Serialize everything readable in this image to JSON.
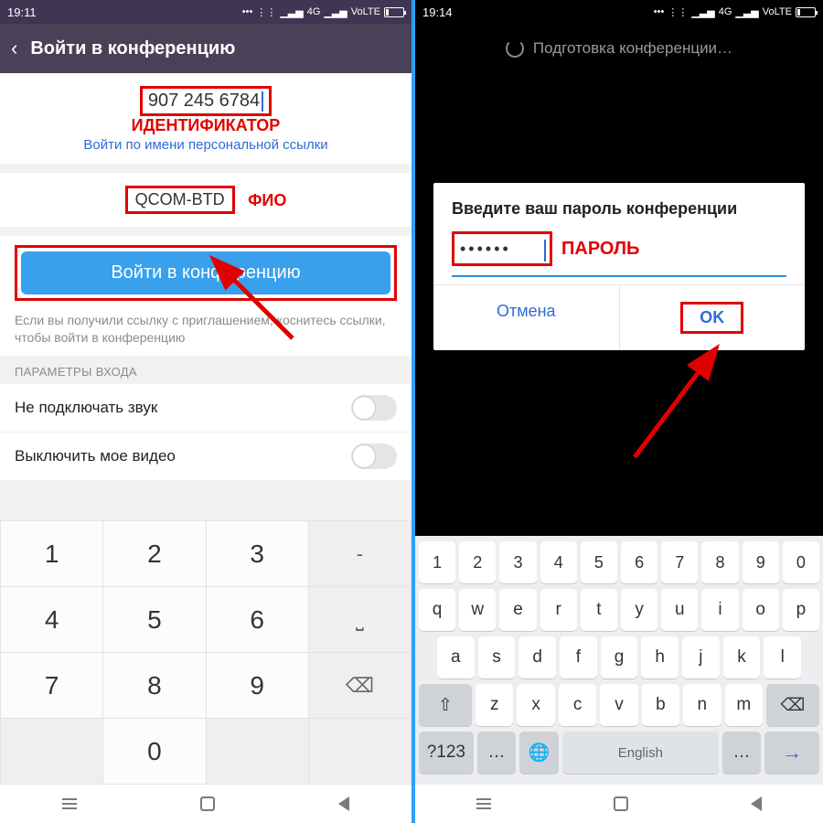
{
  "left": {
    "status_time": "19:11",
    "status_net": "4G",
    "status_volte": "VoLTE",
    "header_title": "Войти в конференцию",
    "meeting_id": "907 245 6784",
    "anno_id": "ИДЕНТИФИКАТОР",
    "link_text": "Войти по имени персональной ссылки",
    "name_value": "QCOM-BTD",
    "anno_fio": "ФИО",
    "join_label": "Войти в конференцию",
    "hint_text": "Если вы получили ссылку с приглашением, коснитесь ссылки, чтобы войти в конференцию",
    "params_header": "ПАРАМЕТРЫ ВХОДА",
    "opt_audio": "Не подключать звук",
    "opt_video": "Выключить мое видео",
    "keypad": {
      "r1": [
        "1",
        "2",
        "3",
        "-"
      ],
      "r2": [
        "4",
        "5",
        "6",
        "⎵"
      ],
      "r3": [
        "7",
        "8",
        "9",
        "⌫"
      ],
      "r4": [
        "",
        "0",
        "",
        ""
      ]
    }
  },
  "right": {
    "status_time": "19:14",
    "status_net": "4G",
    "status_volte": "VoLTE",
    "loading_text": "Подготовка конференции…",
    "dialog_title": "Введите ваш пароль конференции",
    "password_dots": "••••••",
    "anno_password": "ПАРОЛЬ",
    "cancel": "Отмена",
    "ok": "OK",
    "kbd": {
      "nums": [
        "1",
        "2",
        "3",
        "4",
        "5",
        "6",
        "7",
        "8",
        "9",
        "0"
      ],
      "row1": [
        "q",
        "w",
        "e",
        "r",
        "t",
        "y",
        "u",
        "i",
        "o",
        "p"
      ],
      "row2": [
        "a",
        "s",
        "d",
        "f",
        "g",
        "h",
        "j",
        "k",
        "l"
      ],
      "row3": [
        "z",
        "x",
        "c",
        "v",
        "b",
        "n",
        "m"
      ],
      "shift": "⇧",
      "bksp": "⌫",
      "sym": "?123",
      "globe": "🌐",
      "space": "English",
      "more": "…",
      "enter": "→"
    }
  }
}
